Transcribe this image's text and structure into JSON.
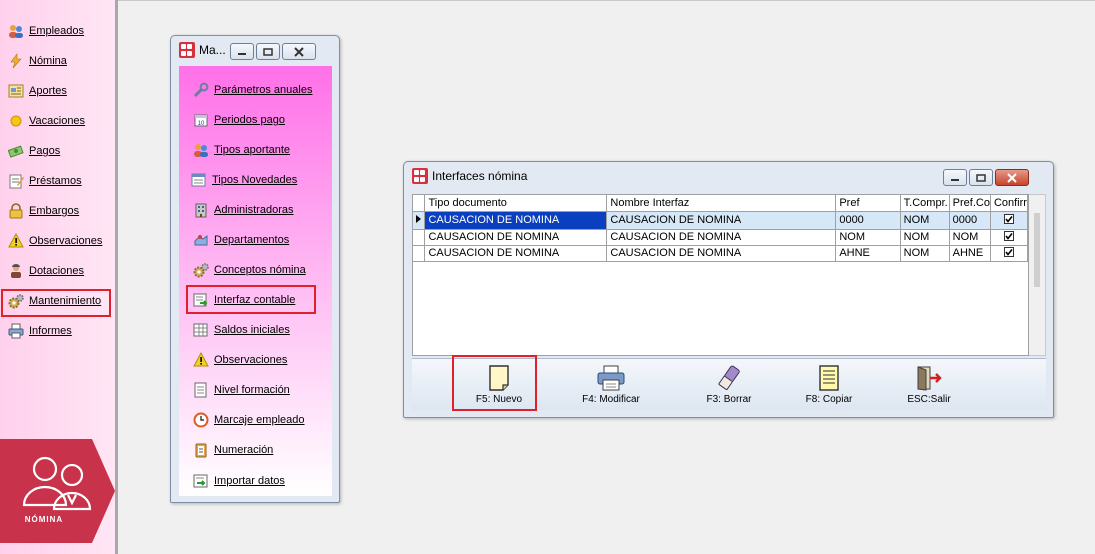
{
  "sidebar": {
    "items": [
      {
        "label": "Empleados",
        "icon": "people-icon"
      },
      {
        "label": "Nómina",
        "icon": "lightning-icon"
      },
      {
        "label": "Aportes",
        "icon": "document-icon"
      },
      {
        "label": "Vacaciones",
        "icon": "sun-icon"
      },
      {
        "label": "Pagos",
        "icon": "money-icon"
      },
      {
        "label": "Préstamos",
        "icon": "notepad-icon"
      },
      {
        "label": "Embargos",
        "icon": "lock-icon"
      },
      {
        "label": "Observaciones",
        "icon": "warning-icon"
      },
      {
        "label": "Dotaciones",
        "icon": "worker-icon"
      },
      {
        "label": "Mantenimiento",
        "icon": "gears-icon"
      },
      {
        "label": "Informes",
        "icon": "printer-icon"
      }
    ],
    "brand_label": "NÓMINA"
  },
  "mant_window": {
    "title": "Ma...",
    "items": [
      {
        "label": "Parámetros anuales",
        "icon": "wrench-icon"
      },
      {
        "label": "Periodos pago",
        "icon": "calendar-icon"
      },
      {
        "label": "Tipos aportante",
        "icon": "people-icon"
      },
      {
        "label": "Tipos Novedades",
        "icon": "list-icon"
      },
      {
        "label": "Administradoras",
        "icon": "building-icon"
      },
      {
        "label": "Departamentos",
        "icon": "map-icon"
      },
      {
        "label": "Conceptos nómina",
        "icon": "gears-icon"
      },
      {
        "label": "Interfaz contable",
        "icon": "export-icon"
      },
      {
        "label": "Saldos iniciales",
        "icon": "grid-icon"
      },
      {
        "label": "Observaciones",
        "icon": "warning-icon"
      },
      {
        "label": "Nivel formación",
        "icon": "page-icon"
      },
      {
        "label": "Marcaje empleado",
        "icon": "clock-icon"
      },
      {
        "label": "Numeración",
        "icon": "numbering-icon"
      },
      {
        "label": "Importar datos",
        "icon": "import-icon"
      }
    ]
  },
  "intf_window": {
    "title": "Interfaces nómina",
    "columns": [
      "Tipo documento",
      "Nombre Interfaz",
      "Pref",
      "T.Compr.",
      "Pref.Co",
      "Confirr"
    ],
    "rows": [
      {
        "tipo": "CAUSACION DE NOMINA",
        "nombre": "CAUSACION DE NOMINA",
        "pref": "0000",
        "tcompr": "NOM",
        "prefco": "0000",
        "confirm": true
      },
      {
        "tipo": "CAUSACION DE NOMINA",
        "nombre": "CAUSACION DE NOMINA",
        "pref": "NOM",
        "tcompr": "NOM",
        "prefco": "NOM",
        "confirm": true
      },
      {
        "tipo": "CAUSACION DE NOMINA",
        "nombre": "CAUSACION DE NOMINA",
        "pref": "AHNE",
        "tcompr": "NOM",
        "prefco": "AHNE",
        "confirm": true
      }
    ],
    "toolbar": [
      {
        "label": "F5: Nuevo",
        "icon": "new-document-icon"
      },
      {
        "label": "F4: Modificar",
        "icon": "printer-icon"
      },
      {
        "label": "F3: Borrar",
        "icon": "eraser-icon"
      },
      {
        "label": "F8: Copiar",
        "icon": "copy-icon"
      },
      {
        "label": "ESC:Salir",
        "icon": "exit-door-icon"
      }
    ]
  },
  "colors": {
    "highlight": "#e0202a",
    "selection": "#0a3fbf",
    "brand": "#c8324a"
  }
}
